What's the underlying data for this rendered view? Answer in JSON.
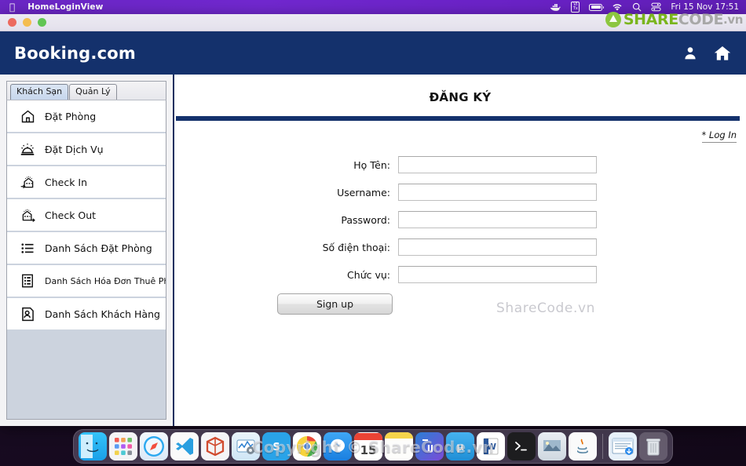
{
  "menubar": {
    "apple_icon": "apple-logo-icon",
    "app_name": "HomeLoginView",
    "icons": [
      {
        "name": "docker-whale-icon",
        "glyph": "🐳"
      },
      {
        "name": "vitx-icon",
        "line1": "VI",
        "line2": "Tx"
      },
      {
        "name": "battery-icon",
        "glyph": ""
      },
      {
        "name": "wifi-icon",
        "glyph": ""
      },
      {
        "name": "search-icon",
        "glyph": ""
      },
      {
        "name": "control-center-icon",
        "glyph": ""
      }
    ],
    "clock": "Fri 15 Nov  17:51"
  },
  "sharecode_logo": {
    "part1": "SHARE",
    "part2": "CODE",
    "part3": ".vn",
    "color1": "#7ab51d",
    "color2": "#a8a8a8",
    "mark_color": "#8cc63f"
  },
  "window": {
    "traffic_lights": [
      "close-red",
      "minimize-yellow",
      "zoom-green"
    ],
    "brand": "Booking.com",
    "brand_bg": "#14316c",
    "header_icons": [
      {
        "name": "user-account-icon"
      },
      {
        "name": "home-icon"
      }
    ]
  },
  "sidebar": {
    "tabs": [
      {
        "label": "Khách Sạn",
        "active": true
      },
      {
        "label": "Quản Lý",
        "active": false
      }
    ],
    "items": [
      {
        "label": "Đặt Phòng",
        "icon": "building-icon",
        "small": false
      },
      {
        "label": "Đặt Dịch Vụ",
        "icon": "service-bell-icon",
        "small": false
      },
      {
        "label": "Check In",
        "icon": "building-arrow-in-icon",
        "small": false
      },
      {
        "label": "Check Out",
        "icon": "building-arrow-out-icon",
        "small": false
      },
      {
        "label": "Danh Sách Đặt Phòng",
        "icon": "list-icon",
        "small": false
      },
      {
        "label": "Danh Sách Hóa Đơn Thuê Ph...",
        "icon": "invoice-grid-icon",
        "small": true
      },
      {
        "label": "Danh Sách Khách Hàng",
        "icon": "customer-document-icon",
        "small": false
      }
    ]
  },
  "main": {
    "title": "ĐĂNG KÝ",
    "login_link": "* Log In",
    "divider_color": "#14316c",
    "watermark": "ShareCode.vn",
    "form": {
      "fields": [
        {
          "label": "Họ Tên:",
          "value": "",
          "placeholder": "",
          "name": "fullname-field"
        },
        {
          "label": "Username:",
          "value": "",
          "placeholder": "",
          "name": "username-field"
        },
        {
          "label": "Password:",
          "value": "",
          "placeholder": "",
          "name": "password-field"
        },
        {
          "label": "Số điện thoại:",
          "value": "",
          "placeholder": "",
          "name": "phone-field"
        },
        {
          "label": "Chức vụ:",
          "value": "",
          "placeholder": "",
          "name": "role-field"
        }
      ],
      "submit_label": "Sign up"
    }
  },
  "dock": {
    "items": [
      {
        "name": "finder-icon"
      },
      {
        "name": "launchpad-icon"
      },
      {
        "name": "safari-icon"
      },
      {
        "name": "vscode-icon"
      },
      {
        "name": "virtualbox-icon"
      },
      {
        "name": "system-monitor-icon"
      },
      {
        "name": "skype-icon"
      },
      {
        "name": "chrome-icon"
      },
      {
        "name": "messenger-icon"
      },
      {
        "name": "calendar-icon",
        "badge": "15"
      },
      {
        "name": "notes-icon"
      },
      {
        "name": "intellij-icon"
      },
      {
        "name": "utorrent-icon"
      },
      {
        "name": "word-icon"
      },
      {
        "name": "terminal-icon"
      },
      {
        "name": "preview-icon"
      },
      {
        "name": "java-icon"
      },
      {
        "name": "finder-window-icon"
      },
      {
        "name": "trash-icon"
      }
    ]
  },
  "watermark_dock": "Copyright © ShareCode.vn"
}
